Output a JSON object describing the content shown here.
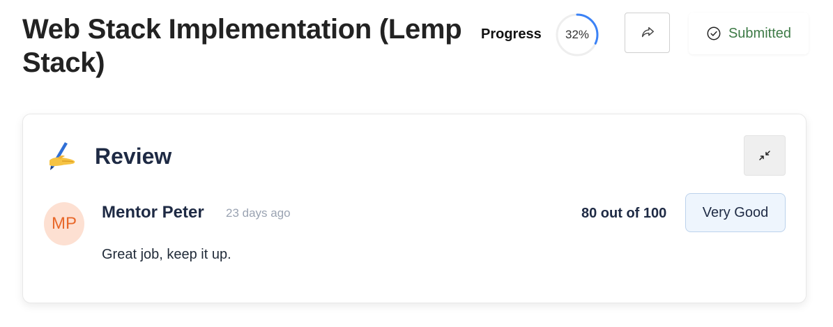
{
  "header": {
    "title": "Web Stack Implementation (Lemp Stack)",
    "progress_label": "Progress",
    "progress_value": 0.32,
    "progress_text": "32%",
    "share_icon": "share-icon",
    "status_icon": "check-circle-icon",
    "status_label": "Submitted",
    "status_color": "#3d7a46",
    "progress_color": "#3b82f6"
  },
  "review": {
    "title": "Review",
    "title_icon": "writing-hand-icon",
    "collapse_icon": "collapse-arrows-icon",
    "reviewer": {
      "initials": "MP",
      "name": "Mentor Peter",
      "time": "23 days ago"
    },
    "score": "80 out of 100",
    "rating": "Very Good",
    "comment": "Great job, keep it up."
  }
}
